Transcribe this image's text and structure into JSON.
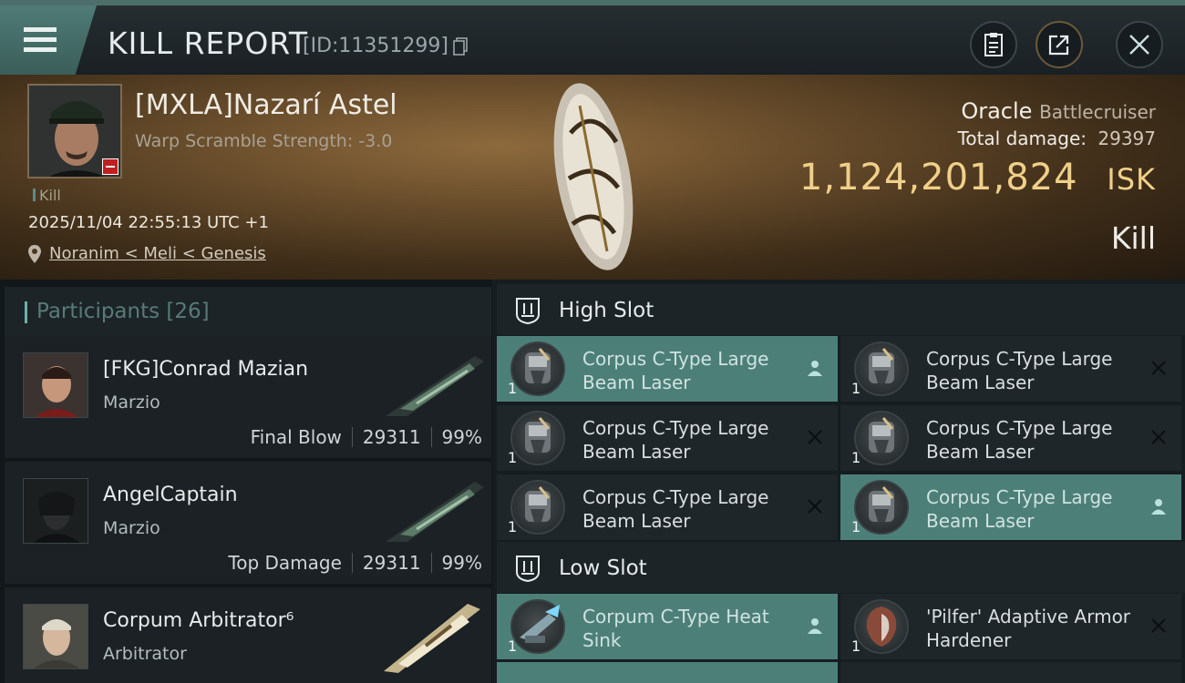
{
  "header": {
    "title": "KILL REPORT",
    "report_id": "[ID:11351299]",
    "icons": {
      "menu": "menu-icon",
      "copy": "copy-icon",
      "clipboard": "clipboard-icon",
      "share": "share-icon",
      "close": "close-icon"
    }
  },
  "victim": {
    "name": "[MXLA]Nazarí Astel",
    "warp_scramble": "Warp Scramble Strength: -3.0",
    "kill_tag": "Kill",
    "datetime": "2025/11/04 22:55:13 UTC +1",
    "location": "Noranim < Meli < Genesis",
    "ship_name": "Oracle",
    "ship_class": "Battlecruiser",
    "total_damage_label": "Total damage:",
    "total_damage_value": "29397",
    "isk_value": "1,124,201,824",
    "isk_unit": "ISK",
    "result": "Kill"
  },
  "participants": {
    "header": "Participants [26]",
    "items": [
      {
        "name": "[FKG]Conrad Mazian",
        "ship": "Marzio",
        "tag": "Final Blow",
        "damage": "29311",
        "percent": "99%"
      },
      {
        "name": "AngelCaptain",
        "ship": "Marzio",
        "tag": "Top Damage",
        "damage": "29311",
        "percent": "99%"
      },
      {
        "name": "Corpum Arbitrator⁶",
        "ship": "Arbitrator"
      }
    ]
  },
  "slots": {
    "high": {
      "label": "High Slot",
      "modules": [
        {
          "name": "Corpus C-Type Large Beam Laser",
          "qty": "1",
          "state": "dropped",
          "status_icon": "person-icon"
        },
        {
          "name": "Corpus C-Type Large Beam Laser",
          "qty": "1",
          "state": "destroyed",
          "status_icon": "x-icon"
        },
        {
          "name": "Corpus C-Type Large Beam Laser",
          "qty": "1",
          "state": "destroyed",
          "status_icon": "x-icon"
        },
        {
          "name": "Corpus C-Type Large Beam Laser",
          "qty": "1",
          "state": "destroyed",
          "status_icon": "x-icon"
        },
        {
          "name": "Corpus C-Type Large Beam Laser",
          "qty": "1",
          "state": "destroyed",
          "status_icon": "x-icon"
        },
        {
          "name": "Corpus C-Type Large Beam Laser",
          "qty": "1",
          "state": "dropped",
          "status_icon": "person-icon"
        }
      ]
    },
    "low": {
      "label": "Low Slot",
      "modules": [
        {
          "name": "Corpum C-Type Heat Sink",
          "qty": "1",
          "state": "dropped",
          "status_icon": "person-icon"
        },
        {
          "name": "'Pilfer' Adaptive Armor Hardener",
          "qty": "1",
          "state": "destroyed",
          "status_icon": "x-icon"
        }
      ]
    }
  },
  "colors": {
    "accent": "#4d7f79",
    "isk": "#f0d089",
    "panel": "#1b2124"
  }
}
